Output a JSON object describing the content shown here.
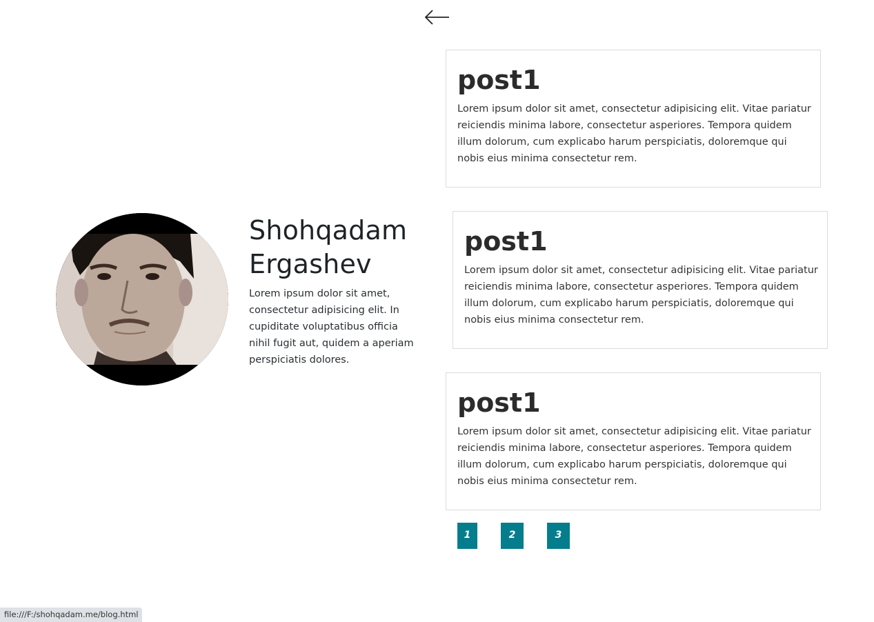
{
  "nav": {
    "back_icon": "arrow-left-icon"
  },
  "profile": {
    "name": "Shohqadam Ergashev",
    "bio": "Lorem ipsum dolor sit amet, consectetur adipisicing elit. In cupiditate voluptatibus officia nihil fugit aut, quidem a aperiam perspiciatis dolores.",
    "avatar_icon": "profile-photo"
  },
  "posts": [
    {
      "title": "post1",
      "body": "Lorem ipsum dolor sit amet, consectetur adipisicing elit. Vitae pariatur reiciendis minima labore, consectetur asperiores. Tempora quidem illum dolorum, cum explicabo harum perspiciatis, doloremque qui nobis eius minima consectetur rem."
    },
    {
      "title": "post1",
      "body": "Lorem ipsum dolor sit amet, consectetur adipisicing elit. Vitae pariatur reiciendis minima labore, consectetur asperiores. Tempora quidem illum dolorum, cum explicabo harum perspiciatis, doloremque qui nobis eius minima consectetur rem."
    },
    {
      "title": "post1",
      "body": "Lorem ipsum dolor sit amet, consectetur adipisicing elit. Vitae pariatur reiciendis minima labore, consectetur asperiores. Tempora quidem illum dolorum, cum explicabo harum perspiciatis, doloremque qui nobis eius minima consectetur rem."
    }
  ],
  "pagination": {
    "pages": [
      "1",
      "2",
      "3"
    ]
  },
  "status_bar": {
    "url": "file:///F:/shohqadam.me/blog.html"
  },
  "colors": {
    "accent": "#057d8d",
    "card_border": "#dcdcdc",
    "text": "#222222"
  }
}
